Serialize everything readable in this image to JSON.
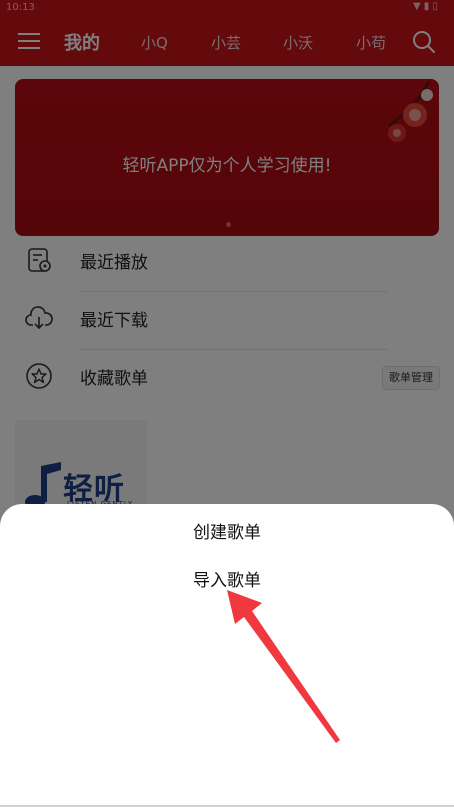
{
  "status_bar": {
    "time": "10:13",
    "icons": "▼ ▮ ▯"
  },
  "header": {
    "tabs": [
      {
        "label": "我的",
        "active": true
      },
      {
        "label": "小Q",
        "active": false
      },
      {
        "label": "小芸",
        "active": false
      },
      {
        "label": "小沃",
        "active": false
      },
      {
        "label": "小苟",
        "active": false
      }
    ]
  },
  "banner": {
    "text": "轻听APP仅为个人学习使用!"
  },
  "menu_list": [
    {
      "label": "最近播放",
      "icon": "recent-play-icon"
    },
    {
      "label": "最近下载",
      "icon": "cloud-download-icon"
    },
    {
      "label": "收藏歌单",
      "icon": "star-icon"
    }
  ],
  "playlist_manage_label": "歌单管理",
  "playlist_cover": {
    "title": "轻听",
    "subtitle": "LISTEN GENTLY"
  },
  "bottom_sheet": {
    "options": [
      {
        "label": "创建歌单"
      },
      {
        "label": "导入歌单"
      }
    ]
  },
  "colors": {
    "brand_red": "#c8141b",
    "annotation_arrow": "#f0393f"
  }
}
